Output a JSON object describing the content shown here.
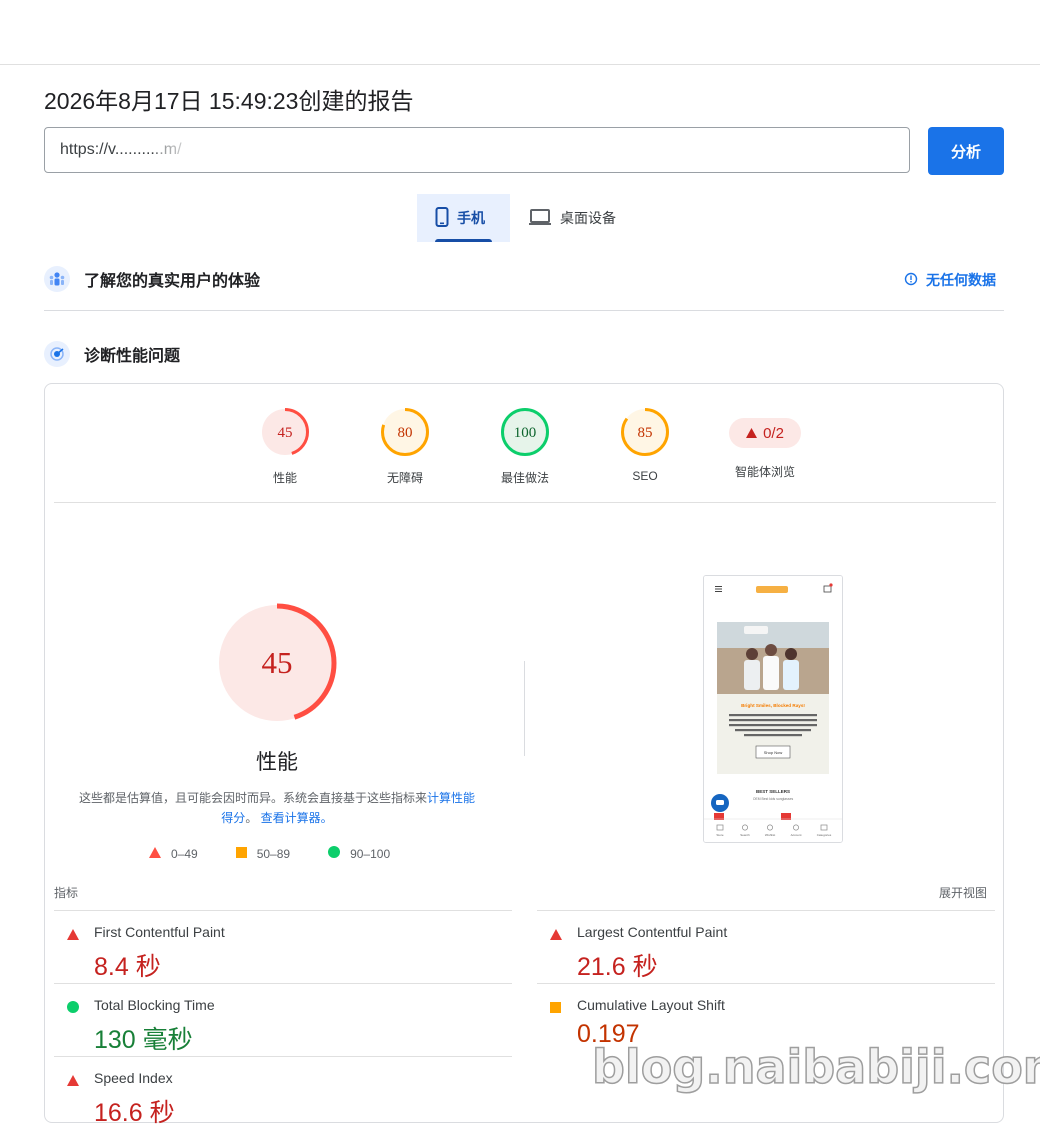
{
  "report": {
    "timestamp_title": "2026年8月17日 15:49:23创建的报告",
    "url_value": "https://v...........m/",
    "analyze_label": "分析"
  },
  "device_tabs": [
    {
      "label": "手机",
      "icon": "smartphone-icon",
      "active": true
    },
    {
      "label": "桌面设备",
      "icon": "laptop-icon",
      "active": false
    }
  ],
  "field_data": {
    "title": "了解您的真实用户的体验",
    "no_data_label": "无任何数据"
  },
  "diagnostics": {
    "title": "诊断性能问题"
  },
  "scores": [
    {
      "label": "性能",
      "value": "45",
      "fraction": 0.45,
      "color": "#ff4e42",
      "bg": "#fce8e6",
      "text": "#c5221f"
    },
    {
      "label": "无障碍",
      "value": "80",
      "fraction": 0.8,
      "color": "#ffa400",
      "bg": "#fff6e5",
      "text": "#c33300"
    },
    {
      "label": "最佳做法",
      "value": "100",
      "fraction": 1.0,
      "color": "#0cce6b",
      "bg": "#e6f4ea",
      "text": "#0d652d"
    },
    {
      "label": "SEO",
      "value": "85",
      "fraction": 0.85,
      "color": "#ffa400",
      "bg": "#fff6e5",
      "text": "#c33300"
    }
  ],
  "agent_score": {
    "label": "智能体浏览",
    "value": "0/2"
  },
  "performance": {
    "score": "45",
    "fraction": 0.45,
    "title": "性能",
    "note_plain": "这些都是估算值，且可能会因时而异。系统会直接基于这些指标来",
    "note_link1": "计算性能得分",
    "note_sep": "。",
    "note_link2": "查看计算器。"
  },
  "legend": [
    {
      "range": "0–49",
      "shape": "triangle",
      "color": "#ff4e42"
    },
    {
      "range": "50–89",
      "shape": "square",
      "color": "#ffa400"
    },
    {
      "range": "90–100",
      "shape": "circle",
      "color": "#0cce6b"
    }
  ],
  "screenshot": {
    "hero_title": "Bright Smiles, Blocked Rays!",
    "hero_text": "Keep tiny eyes safe in the sun. Lightweight, unbreakable frames with 100% UV400 polarized lenses, designed for non-stop summer fun!",
    "cta": "Shop Now",
    "section": "BEST SELLERS",
    "section_sub": "OEM Best kids sunglasses",
    "nav": [
      "Store",
      "Search",
      "Wishlist",
      "Account",
      "Categories"
    ]
  },
  "metrics_section": {
    "label": "指标",
    "expand": "展开视图"
  },
  "metrics": [
    {
      "name": "First Contentful Paint",
      "value": "8.4 秒",
      "status": "fail"
    },
    {
      "name": "Largest Contentful Paint",
      "value": "21.6 秒",
      "status": "fail"
    },
    {
      "name": "Total Blocking Time",
      "value": "130 毫秒",
      "status": "pass"
    },
    {
      "name": "Cumulative Layout Shift",
      "value": "0.197",
      "status": "average"
    },
    {
      "name": "Speed Index",
      "value": "16.6 秒",
      "status": "fail"
    }
  ],
  "watermark": "blog.naibabiji.com"
}
